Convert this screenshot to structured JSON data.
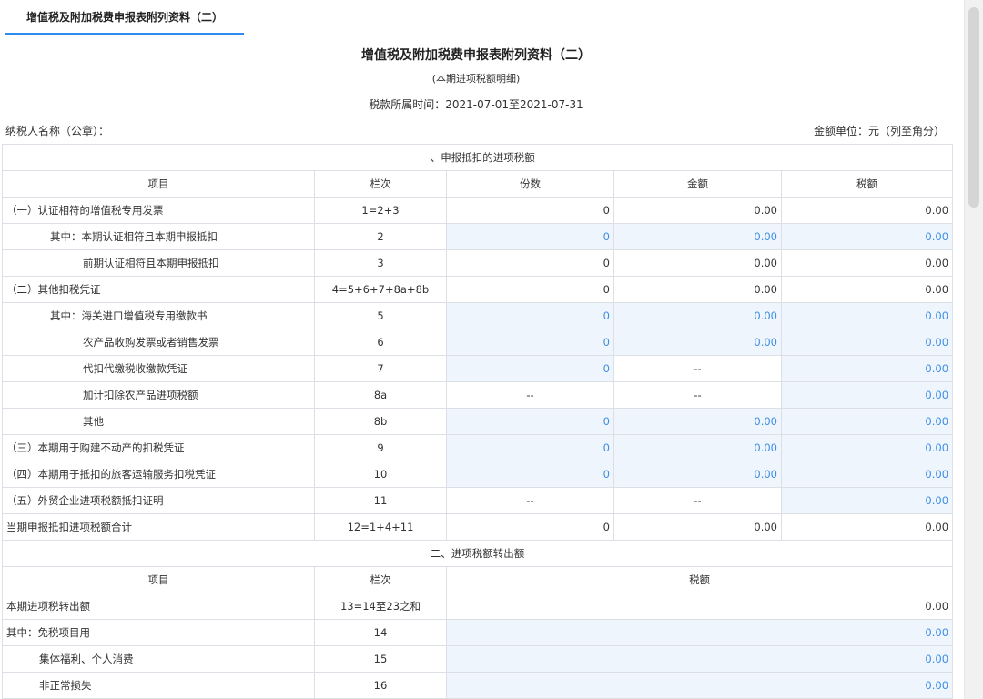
{
  "tab": {
    "label": "增值税及附加税费申报表附列资料（二）"
  },
  "header": {
    "title": "增值税及附加税费申报表附列资料（二）",
    "subtitle": "(本期进项税额明细)",
    "period": "税款所属时间：2021-07-01至2021-07-31",
    "taxpayer_label": "纳税人名称（公章）：",
    "unit_label": "金额单位：元（列至角分）"
  },
  "section1": {
    "title": "一、申报抵扣的进项税额",
    "headers": [
      "项目",
      "栏次",
      "份数",
      "金额",
      "税额"
    ],
    "rows": [
      {
        "item": "（一）认证相符的增值税专用发票",
        "col": "1=2+3",
        "count": "0",
        "amount": "0.00",
        "tax": "0.00"
      },
      {
        "item": "其中：本期认证相符且本期申报抵扣",
        "col": "2",
        "count": "0",
        "amount": "0.00",
        "tax": "0.00"
      },
      {
        "item": "前期认证相符且本期申报抵扣",
        "col": "3",
        "count": "0",
        "amount": "0.00",
        "tax": "0.00"
      },
      {
        "item": "（二）其他扣税凭证",
        "col": "4=5+6+7+8a+8b",
        "count": "0",
        "amount": "0.00",
        "tax": "0.00"
      },
      {
        "item": "其中：海关进口增值税专用缴款书",
        "col": "5",
        "count": "0",
        "amount": "0.00",
        "tax": "0.00"
      },
      {
        "item": "农产品收购发票或者销售发票",
        "col": "6",
        "count": "0",
        "amount": "0.00",
        "tax": "0.00"
      },
      {
        "item": "代扣代缴税收缴款凭证",
        "col": "7",
        "count": "0",
        "amount": "--",
        "tax": "0.00"
      },
      {
        "item": "加计扣除农产品进项税额",
        "col": "8a",
        "count": "--",
        "amount": "--",
        "tax": "0.00"
      },
      {
        "item": "其他",
        "col": "8b",
        "count": "0",
        "amount": "0.00",
        "tax": "0.00"
      },
      {
        "item": "（三）本期用于购建不动产的扣税凭证",
        "col": "9",
        "count": "0",
        "amount": "0.00",
        "tax": "0.00"
      },
      {
        "item": "（四）本期用于抵扣的旅客运输服务扣税凭证",
        "col": "10",
        "count": "0",
        "amount": "0.00",
        "tax": "0.00"
      },
      {
        "item": "（五）外贸企业进项税额抵扣证明",
        "col": "11",
        "count": "--",
        "amount": "--",
        "tax": "0.00"
      },
      {
        "item": "当期申报抵扣进项税额合计",
        "col": "12=1+4+11",
        "count": "0",
        "amount": "0.00",
        "tax": "0.00"
      }
    ]
  },
  "section2": {
    "title": "二、进项税额转出额",
    "headers": [
      "项目",
      "栏次",
      "税额"
    ],
    "rows": [
      {
        "item": "本期进项税转出额",
        "col": "13=14至23之和",
        "tax": "0.00"
      },
      {
        "item": "其中：免税项目用",
        "col": "14",
        "tax": "0.00"
      },
      {
        "item": "集体福利、个人消费",
        "col": "15",
        "tax": "0.00"
      },
      {
        "item": "非正常损失",
        "col": "16",
        "tax": "0.00"
      }
    ]
  },
  "colors": {
    "accent": "#2d8cf0",
    "editable_bg": "#eef5fd",
    "editable_text": "#3d8de3"
  }
}
